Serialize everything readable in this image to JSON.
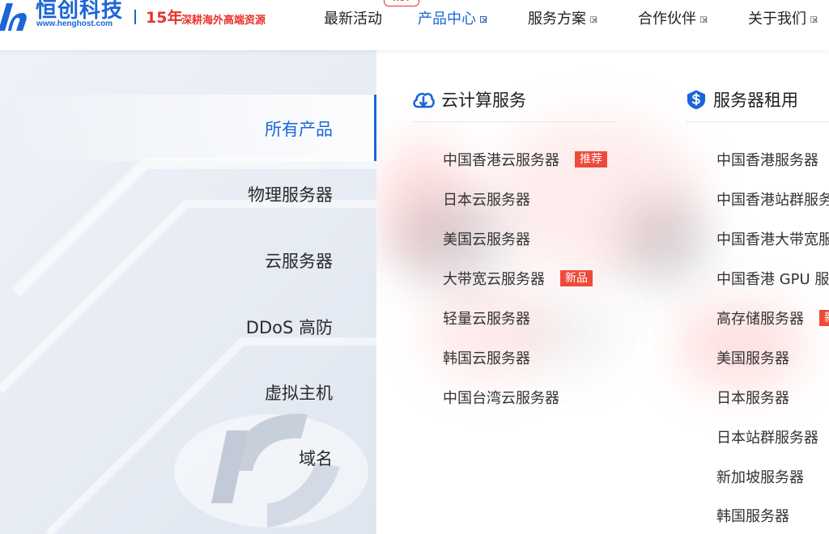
{
  "header": {
    "logo_name": "恒创科技",
    "logo_url": "www.henghost.com",
    "slogan_years": "15年",
    "slogan_text": "深耕海外高端资源",
    "hot_badge": "HOT",
    "nav": [
      {
        "label": "最新活动",
        "active": false,
        "has_caret": false
      },
      {
        "label": "产品中心",
        "active": true,
        "has_caret": true
      },
      {
        "label": "服务方案",
        "active": false,
        "has_caret": true
      },
      {
        "label": "合作伙伴",
        "active": false,
        "has_caret": true
      },
      {
        "label": "关于我们",
        "active": false,
        "has_caret": true
      }
    ],
    "caret_glyph": "×"
  },
  "categories": [
    {
      "label": "所有产品",
      "active": true
    },
    {
      "label": "物理服务器",
      "active": false
    },
    {
      "label": "云服务器",
      "active": false
    },
    {
      "label": "DDoS 高防",
      "active": false
    },
    {
      "label": "虚拟主机",
      "active": false
    },
    {
      "label": "域名",
      "active": false
    }
  ],
  "columns": [
    {
      "title": "云计算服务",
      "icon": "cloud-icon",
      "items": [
        {
          "label": "中国香港云服务器",
          "tag": "推荐"
        },
        {
          "label": "日本云服务器",
          "tag": ""
        },
        {
          "label": "美国云服务器",
          "tag": ""
        },
        {
          "label": "大带宽云服务器",
          "tag": "新品"
        },
        {
          "label": "轻量云服务器",
          "tag": ""
        },
        {
          "label": "韩国云服务器",
          "tag": ""
        },
        {
          "label": "中国台湾云服务器",
          "tag": ""
        }
      ]
    },
    {
      "title": "服务器租用",
      "icon": "dollar-shield-icon",
      "items": [
        {
          "label": "中国香港服务器",
          "tag": ""
        },
        {
          "label": "中国香港站群服务器",
          "tag": ""
        },
        {
          "label": "中国香港大带宽服务器",
          "tag": ""
        },
        {
          "label": "中国香港 GPU 服务器",
          "tag": ""
        },
        {
          "label": "高存储服务器",
          "tag": "新品"
        },
        {
          "label": "美国服务器",
          "tag": ""
        },
        {
          "label": "日本服务器",
          "tag": ""
        },
        {
          "label": "日本站群服务器",
          "tag": ""
        },
        {
          "label": "新加坡服务器",
          "tag": ""
        },
        {
          "label": "韩国服务器",
          "tag": ""
        }
      ]
    }
  ],
  "colors": {
    "brand_blue": "#1a66d6",
    "accent_red": "#e8322c",
    "tag_red": "#ee4a3a"
  }
}
